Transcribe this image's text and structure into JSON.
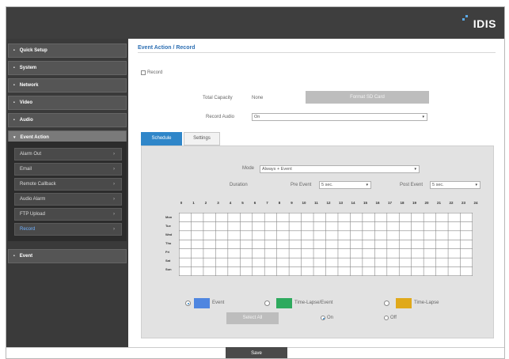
{
  "brand": {
    "logo_text": "IDIS"
  },
  "sidebar": {
    "menu": [
      {
        "label": "Quick Setup"
      },
      {
        "label": "System"
      },
      {
        "label": "Network"
      },
      {
        "label": "Video"
      },
      {
        "label": "Audio"
      },
      {
        "label": "Event Action"
      },
      {
        "label": "Event"
      }
    ],
    "submenu": [
      {
        "label": "Alarm Out"
      },
      {
        "label": "Email"
      },
      {
        "label": "Remote Callback"
      },
      {
        "label": "Audio Alarm"
      },
      {
        "label": "FTP Upload"
      },
      {
        "label": "Record"
      }
    ]
  },
  "main": {
    "title": "Event Action / Record",
    "record_checkbox_label": "Record",
    "total_capacity_label": "Total Capacity",
    "total_capacity_value": "None",
    "format_button": "Format SD Card",
    "record_audio_label": "Record Audio",
    "record_audio_value": "On",
    "tabs": [
      {
        "label": "Schedule"
      },
      {
        "label": "Settings"
      }
    ],
    "mode_label": "Mode",
    "mode_value": "Always + Event",
    "duration_label": "Duration",
    "pre_event_label": "Pre Event",
    "pre_event_value": "5 sec.",
    "post_event_label": "Post Event",
    "post_event_value": "5 sec.",
    "hours": [
      "0",
      "1",
      "2",
      "3",
      "4",
      "5",
      "6",
      "7",
      "8",
      "9",
      "10",
      "11",
      "12",
      "13",
      "14",
      "15",
      "16",
      "17",
      "18",
      "19",
      "20",
      "21",
      "22",
      "23",
      "24"
    ],
    "days": [
      "Mon",
      "Tue",
      "Wed",
      "Thu",
      "Fri",
      "Sat",
      "Sun"
    ],
    "legend": [
      {
        "label": "Event",
        "color": "#4f86e0"
      },
      {
        "label": "Time-Lapse/Event",
        "color": "#2eaa5e"
      },
      {
        "label": "Time-Lapse",
        "color": "#e0a91b"
      }
    ],
    "select_all_button": "Select All",
    "on_label": "On",
    "off_label": "Off"
  },
  "footer": {
    "save_button": "Save"
  }
}
